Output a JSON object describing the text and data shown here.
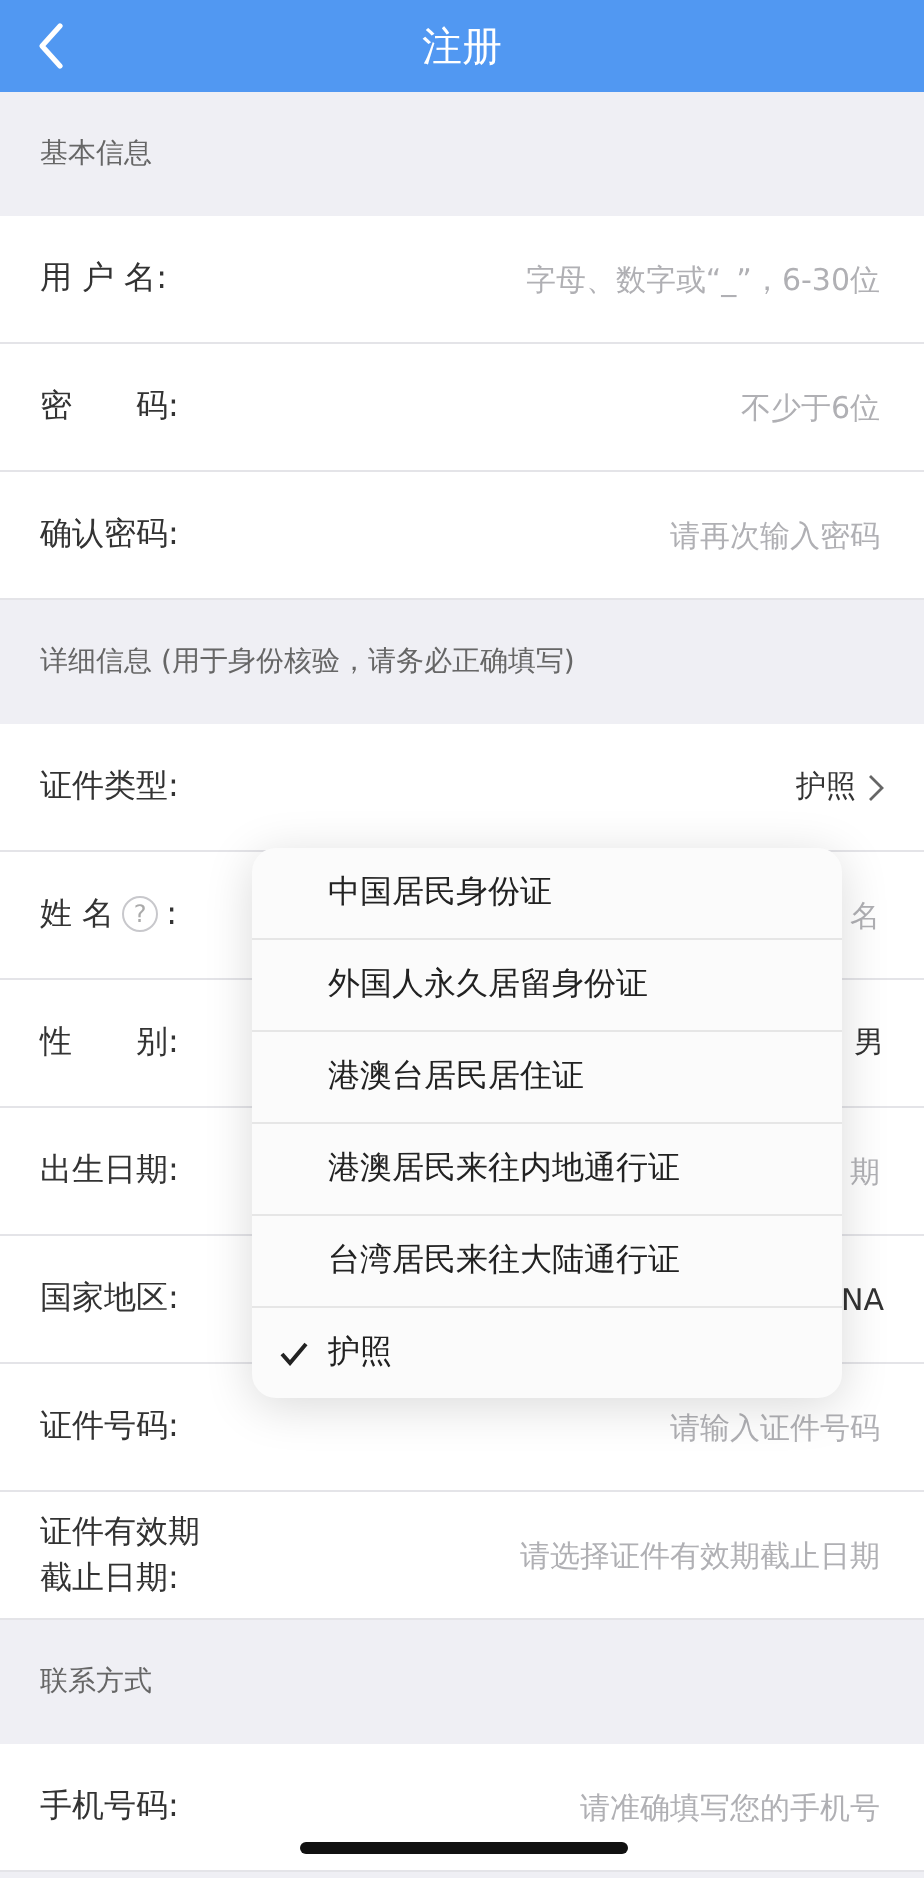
{
  "nav_bar": {
    "title": "注册"
  },
  "sections": [
    {
      "title": "基本信息",
      "rows": [
        {
          "kind": "input",
          "label": "用 户 名:",
          "placeholder": "字母、数字或“_”，6-30位"
        },
        {
          "kind": "input",
          "label": "密　　码:",
          "placeholder": "不少于6位"
        },
        {
          "kind": "input",
          "label": "确认密码:",
          "placeholder": "请再次输入密码"
        }
      ]
    },
    {
      "title": "详细信息 (用于身份核验，请务必正确填写)",
      "rows": [
        {
          "kind": "picker",
          "label": "证件类型:",
          "value": "护照"
        },
        {
          "kind": "input",
          "label": "姓 名",
          "help": "?",
          "suffix": ":",
          "placeholder": "名"
        },
        {
          "kind": "value",
          "label": "性　　别:",
          "value": "男"
        },
        {
          "kind": "input",
          "label": "出生日期:",
          "placeholder": "期"
        },
        {
          "kind": "value",
          "label": "国家地区:",
          "value": "NA"
        },
        {
          "kind": "input",
          "label": "证件号码:",
          "placeholder": "请输入证件号码"
        },
        {
          "kind": "input",
          "label": "证件有效期截止日期:",
          "placeholder": "请选择证件有效期截止日期"
        }
      ]
    },
    {
      "title": "联系方式",
      "rows": [
        {
          "kind": "input",
          "label": "手机号码:",
          "placeholder": "请准确填写您的手机号"
        }
      ]
    }
  ],
  "dropdown": {
    "options": [
      {
        "label": "中国居民身份证",
        "selected": false
      },
      {
        "label": "外国人永久居留身份证",
        "selected": false
      },
      {
        "label": "港澳台居民居住证",
        "selected": false
      },
      {
        "label": "港澳居民来往内地通行证",
        "selected": false
      },
      {
        "label": "台湾居民来往大陆通行证",
        "selected": false
      },
      {
        "label": "护照",
        "selected": true
      }
    ]
  }
}
